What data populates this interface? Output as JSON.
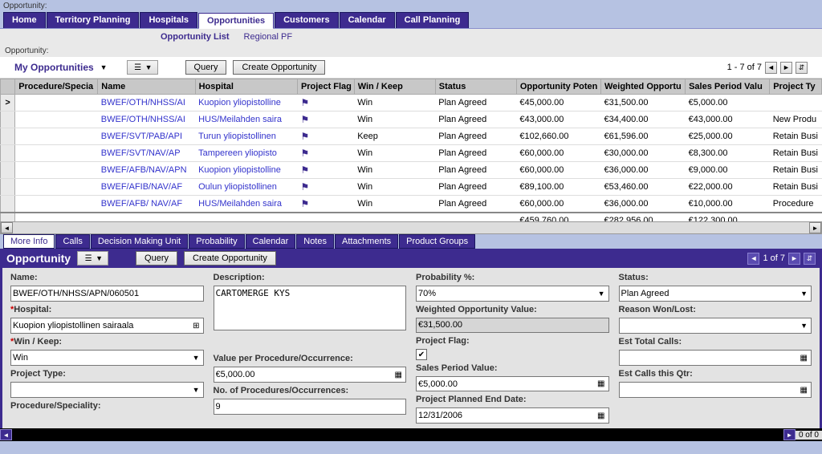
{
  "app": {
    "opportunity_label": "Opportunity:"
  },
  "main_tabs": [
    "Home",
    "Territory Planning",
    "Hospitals",
    "Opportunities",
    "Customers",
    "Calendar",
    "Call Planning"
  ],
  "main_tab_active": 3,
  "sub_links": [
    "Opportunity List",
    "Regional PF"
  ],
  "sub_link_active": 0,
  "list": {
    "section_label": "Opportunity:",
    "title": "My Opportunities",
    "query_btn": "Query",
    "create_btn": "Create Opportunity",
    "counter": "1 - 7 of 7",
    "columns": [
      "Procedure/Specia",
      "Name",
      "Hospital",
      "Project Flag",
      "Win / Keep",
      "Status",
      "Opportunity Poten",
      "Weighted Opportu",
      "Sales Period Valu",
      "Project Ty"
    ],
    "rows": [
      {
        "name": "BWEF/OTH/NHSS/AI",
        "hospital": "Kuopion yliopistolline",
        "flag": true,
        "winkeep": "Win",
        "status": "Plan Agreed",
        "potential": "€45,000.00",
        "weighted": "€31,500.00",
        "sales": "€5,000.00",
        "ptype": ""
      },
      {
        "name": "BWEF/OTH/NHSS/AI",
        "hospital": "HUS/Meilahden saira",
        "flag": true,
        "winkeep": "Win",
        "status": "Plan Agreed",
        "potential": "€43,000.00",
        "weighted": "€34,400.00",
        "sales": "€43,000.00",
        "ptype": "New Produ"
      },
      {
        "name": "BWEF/SVT/PAB/API",
        "hospital": "Turun yliopistollinen",
        "flag": true,
        "winkeep": "Keep",
        "status": "Plan Agreed",
        "potential": "€102,660.00",
        "weighted": "€61,596.00",
        "sales": "€25,000.00",
        "ptype": "Retain Busi"
      },
      {
        "name": "BWEF/SVT/NAV/AP",
        "hospital": "Tampereen yliopisto",
        "flag": true,
        "winkeep": "Win",
        "status": "Plan Agreed",
        "potential": "€60,000.00",
        "weighted": "€30,000.00",
        "sales": "€8,300.00",
        "ptype": "Retain Busi"
      },
      {
        "name": "BWEF/AFB/NAV/APN",
        "hospital": "Kuopion yliopistolline",
        "flag": true,
        "winkeep": "Win",
        "status": "Plan Agreed",
        "potential": "€60,000.00",
        "weighted": "€36,000.00",
        "sales": "€9,000.00",
        "ptype": "Retain Busi"
      },
      {
        "name": "BWEF/AFIB/NAV/AF",
        "hospital": "Oulun yliopistollinen",
        "flag": true,
        "winkeep": "Win",
        "status": "Plan Agreed",
        "potential": "€89,100.00",
        "weighted": "€53,460.00",
        "sales": "€22,000.00",
        "ptype": "Retain Busi"
      },
      {
        "name": "BWEF/AFB/ NAV/AF",
        "hospital": "HUS/Meilahden saira",
        "flag": true,
        "winkeep": "Win",
        "status": "Plan Agreed",
        "potential": "€60,000.00",
        "weighted": "€36,000.00",
        "sales": "€10,000.00",
        "ptype": "Procedure"
      }
    ],
    "totals": {
      "potential": "€459,760.00",
      "weighted": "€282,956.00",
      "sales": "€122,300.00"
    }
  },
  "detail_tabs": [
    "More Info",
    "Calls",
    "Decision Making Unit",
    "Probability",
    "Calendar",
    "Notes",
    "Attachments",
    "Product Groups"
  ],
  "detail_tab_active": 0,
  "detail": {
    "title": "Opportunity",
    "query_btn": "Query",
    "create_btn": "Create Opportunity",
    "counter": "1 of 7",
    "fields": {
      "name_label": "Name:",
      "name_value": "BWEF/OTH/NHSS/APN/060501",
      "hospital_label": "Hospital:",
      "hospital_value": "Kuopion yliopistollinen sairaala",
      "winkeep_label": "Win / Keep:",
      "winkeep_value": "Win",
      "projtype_label": "Project Type:",
      "projtype_value": "",
      "procspec_label": "Procedure/Speciality:",
      "desc_label": "Description:",
      "desc_value": "CARTOMERGE KYS",
      "valper_label": "Value per Procedure/Occurrence:",
      "valper_value": "€5,000.00",
      "noproc_label": "No. of Procedures/Occurrences:",
      "noproc_value": "9",
      "prob_label": "Probability %:",
      "prob_value": "70%",
      "wov_label": "Weighted Opportunity Value:",
      "wov_value": "€31,500.00",
      "pflag_label": "Project Flag:",
      "pflag_checked": true,
      "spv_label": "Sales Period Value:",
      "spv_value": "€5,000.00",
      "pped_label": "Project Planned End Date:",
      "pped_value": "12/31/2006",
      "status_label": "Status:",
      "status_value": "Plan Agreed",
      "rwl_label": "Reason Won/Lost:",
      "rwl_value": "",
      "etc_label": "Est Total Calls:",
      "etc_value": "",
      "ecq_label": "Est Calls this Qtr:",
      "ecq_value": ""
    }
  },
  "status": {
    "counter": "0 of 0"
  }
}
